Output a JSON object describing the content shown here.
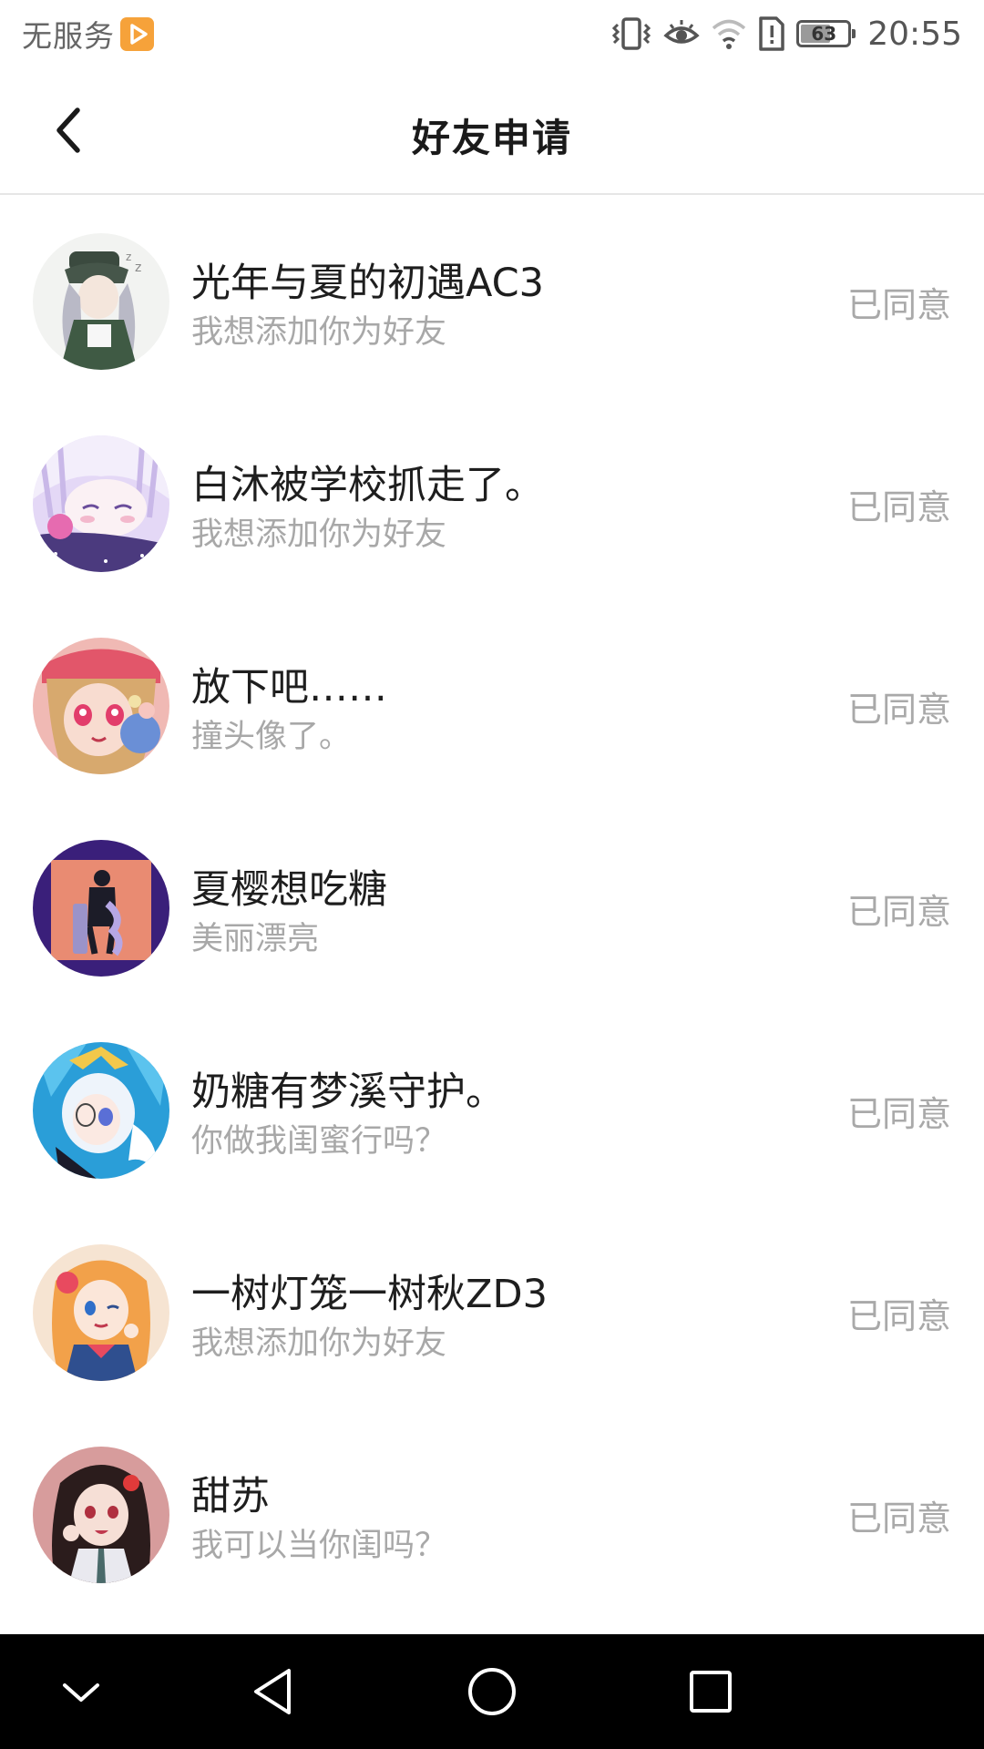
{
  "status_bar": {
    "carrier": "无服务",
    "battery": "63",
    "battery_level": 0.63,
    "time": "20:55",
    "icons": [
      "vibrate-icon",
      "eye-comfort-icon",
      "wifi-icon",
      "sim-alert-icon",
      "battery-icon"
    ]
  },
  "header": {
    "title": "好友申请",
    "back_icon": "chevron-left-icon"
  },
  "requests": [
    {
      "name": "光年与夏的初遇AC3",
      "message": "我想添加你为好友",
      "status": "已同意",
      "avatar_colors": [
        "#eef0ee",
        "#3b4a3f",
        "#b9b9c6"
      ]
    },
    {
      "name": "白沐被学校抓走了。",
      "message": "我想添加你为好友",
      "status": "已同意",
      "avatar_colors": [
        "#d9cdf0",
        "#6a4d9b",
        "#f3eefb"
      ]
    },
    {
      "name": "放下吧……",
      "message": "撞头像了。",
      "status": "已同意",
      "avatar_colors": [
        "#e88b8d",
        "#c9a06a",
        "#f4d6c8"
      ]
    },
    {
      "name": "夏樱想吃糖",
      "message": "美丽漂亮",
      "status": "已同意",
      "avatar_colors": [
        "#3a1f7a",
        "#e98b72",
        "#1c1c28"
      ]
    },
    {
      "name": "奶糖有梦溪守护。",
      "message": "你做我闺蜜行吗？",
      "status": "已同意",
      "avatar_colors": [
        "#2a9ed8",
        "#eef4fb",
        "#f2c84b"
      ]
    },
    {
      "name": "一树灯笼一树秋ZD3",
      "message": "我想添加你为好友",
      "status": "已同意",
      "avatar_colors": [
        "#f6e4d2",
        "#f2a14a",
        "#2f4f8f"
      ]
    },
    {
      "name": "甜苏",
      "message": "我可以当你闺吗？",
      "status": "已同意",
      "avatar_colors": [
        "#d79c9c",
        "#2b1c1c",
        "#f2d7cc"
      ]
    }
  ],
  "nav_bar": {
    "buttons": [
      "hide-icon",
      "back-triangle-icon",
      "home-circle-icon",
      "recents-square-icon"
    ]
  }
}
